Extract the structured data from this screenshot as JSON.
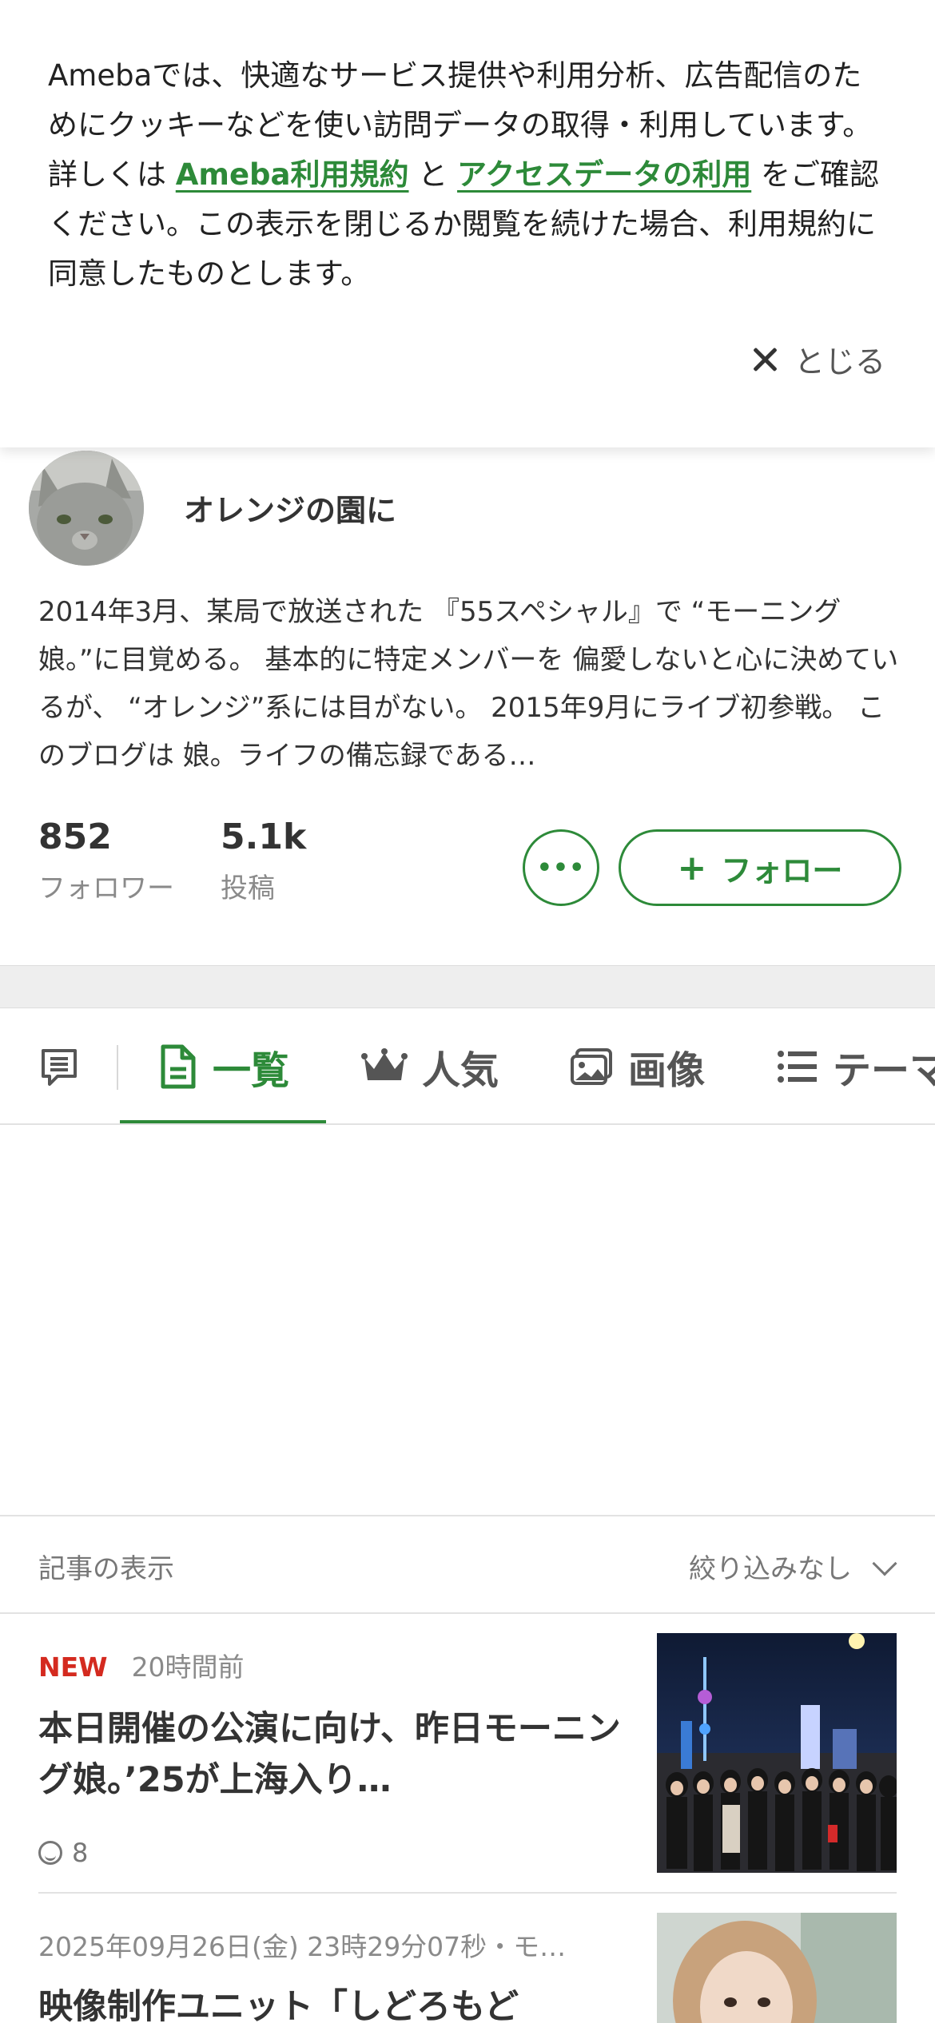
{
  "cookie": {
    "text_before": "Amebaでは、快適なサービス提供や利用分析、広告配信のためにクッキーなどを使い訪問データの取得・利用しています。詳しくは ",
    "link1": "Ameba利用規約",
    "text_mid": " と ",
    "link2": "アクセスデータの利用",
    "text_after": " をご確認ください。この表示を閉じるか閲覧を続けた場合、利用規約に同意したものとします。",
    "close_label": "とじる"
  },
  "profile": {
    "blog_name": "オレンジの園に",
    "bio": "2014年3月、某局で放送された 『55スペシャル』で “モーニング娘。”に目覚める。 基本的に特定メンバーを 偏愛しないと心に決めているが、 “オレンジ”系には目がない。 2015年9月にライブ初参戦。 このブログは 娘。ライフの備忘録である…",
    "followers_count": "852",
    "followers_label": "フォロワー",
    "posts_count": "5.1k",
    "posts_label": "投稿",
    "more_label": "•••",
    "follow_label": "フォロー"
  },
  "tabs": [
    {
      "label": "一覧",
      "icon": "document-icon",
      "active": true
    },
    {
      "label": "人気",
      "icon": "crown-icon"
    },
    {
      "label": "画像",
      "icon": "image-icon"
    },
    {
      "label": "テーマ",
      "icon": "list-icon"
    }
  ],
  "filter": {
    "label": "記事の表示",
    "value": "絞り込みなし"
  },
  "articles": [
    {
      "badge": "NEW",
      "time": "20時間前",
      "title": "本日開催の公演に向け、昨日モーニング娘。’25が上海入り…",
      "reactions": "8"
    },
    {
      "time": "2025年09月26日(金) 23時29分07秒・モ…",
      "title": "映像制作ユニット「しどろもど"
    }
  ],
  "colors": {
    "accent": "#2d8a39",
    "new_badge": "#d42a1f"
  }
}
